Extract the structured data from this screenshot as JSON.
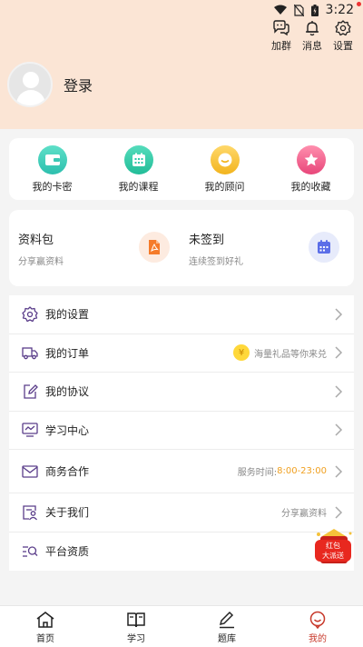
{
  "status_bar": {
    "time": "3:22"
  },
  "top_actions": [
    {
      "label": "加群",
      "icon": "chat-bubbles-icon"
    },
    {
      "label": "消息",
      "icon": "bell-icon"
    },
    {
      "label": "设置",
      "icon": "gear-icon"
    }
  ],
  "profile": {
    "login": "登录"
  },
  "quick_links": [
    {
      "label": "我的卡密",
      "icon": "wallet-icon",
      "color": "#3cc8b4"
    },
    {
      "label": "我的课程",
      "icon": "calendar-icon",
      "color": "#2fcaa8"
    },
    {
      "label": "我的顾问",
      "icon": "chat-smile-icon",
      "color": "#f5c23a"
    },
    {
      "label": "我的收藏",
      "icon": "star-icon",
      "color": "#f06a8c"
    }
  ],
  "features": [
    {
      "title": "资料包",
      "subtitle": "分享赢资料",
      "icon": "pdf-icon"
    },
    {
      "title": "未签到",
      "subtitle": "连续签到好礼",
      "icon": "calendar-check-icon"
    }
  ],
  "menu": [
    {
      "label": "我的设置",
      "icon": "gear-outline-icon"
    },
    {
      "label": "我的订单",
      "icon": "truck-icon",
      "extra": "海量礼品等你来兑"
    },
    {
      "label": "我的协议",
      "icon": "edit-doc-icon"
    },
    {
      "label": "学习中心",
      "icon": "monitor-icon"
    },
    {
      "label": "商务合作",
      "icon": "mail-icon",
      "extra_prefix": "服务时间:",
      "extra_accent": "8:00-23:00"
    },
    {
      "label": "关于我们",
      "icon": "user-card-icon",
      "extra": "分享赢资料"
    },
    {
      "label": "平台资质",
      "icon": "list-search-icon"
    }
  ],
  "redpack": {
    "line1": "红包",
    "line2": "大派送"
  },
  "tabs": [
    {
      "label": "首页",
      "icon": "home-icon"
    },
    {
      "label": "学习",
      "icon": "book-icon"
    },
    {
      "label": "题库",
      "icon": "pen-icon"
    },
    {
      "label": "我的",
      "icon": "profile-icon",
      "active": true
    }
  ],
  "colors": {
    "header_bg": "#fbe5d5",
    "accent_orange": "#f0a020",
    "active_tab": "#c8392b"
  }
}
